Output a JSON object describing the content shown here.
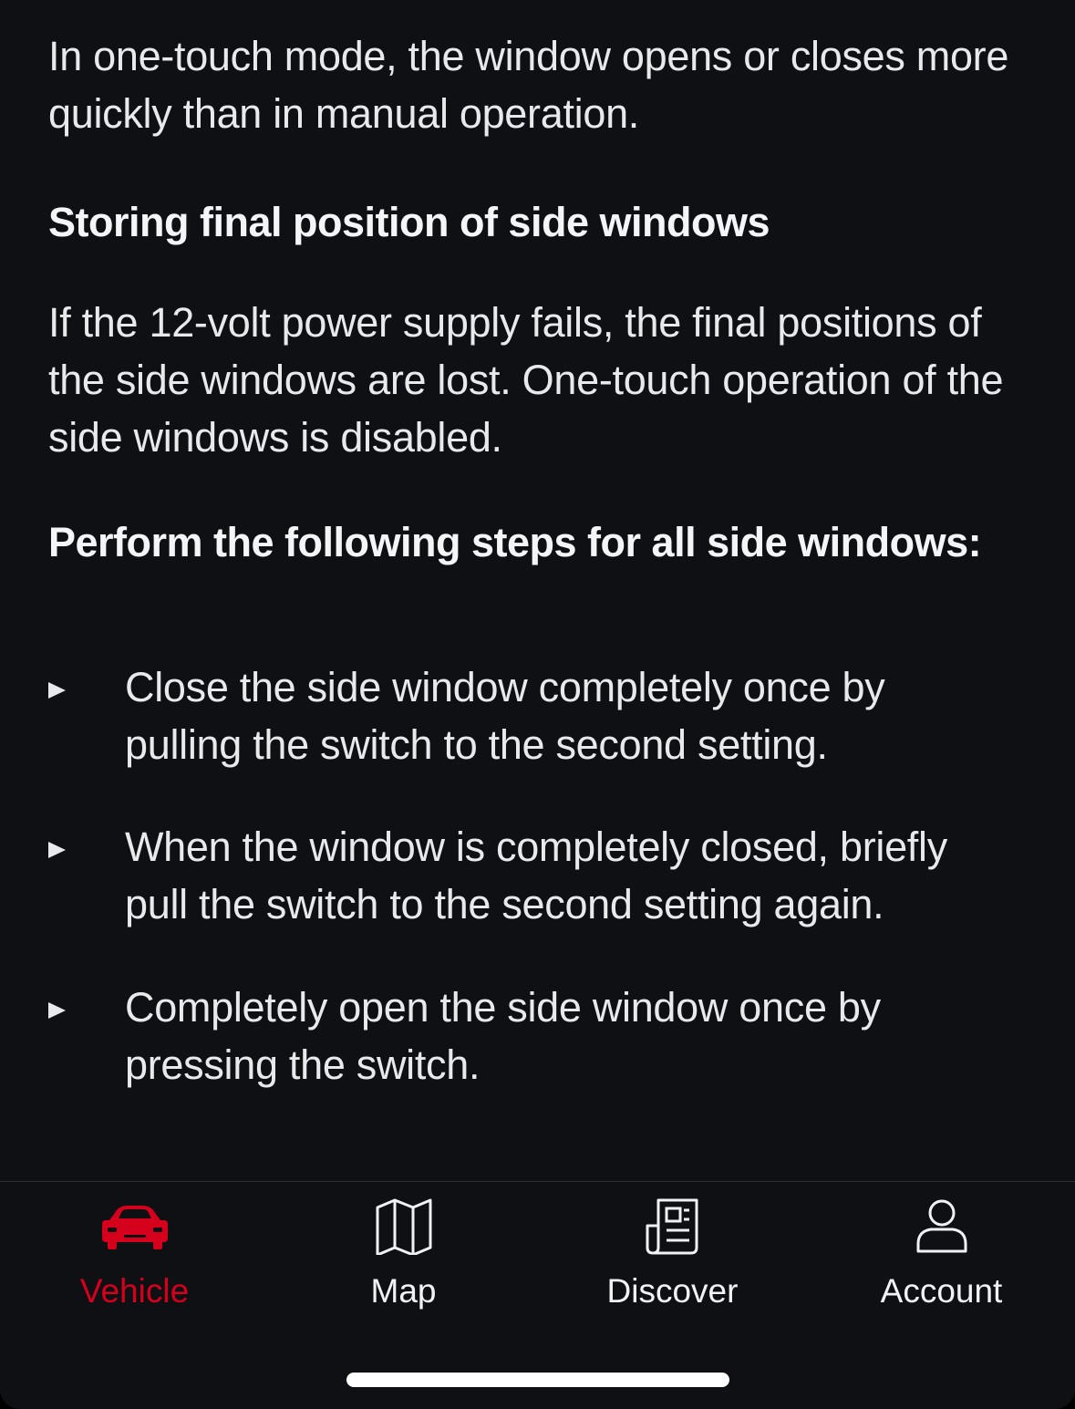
{
  "content": {
    "intro": "In one-touch mode, the window opens or closes more quickly than in manual operation.",
    "section_heading": "Storing final position of side windows",
    "section_text": "If the 12-volt power supply fails, the final positions of the side windows are lost. One-touch operation of the side windows is disabled.",
    "steps_heading": "Perform the following steps for all side windows:",
    "steps": [
      {
        "text": "Close the side window completely once by pulling the switch to the second setting."
      },
      {
        "text": "When the window is completely closed, briefly pull the switch to the second setting again."
      },
      {
        "text": "Completely open the side window once by pressing the switch."
      }
    ]
  },
  "tabbar": {
    "active": "Vehicle",
    "accent_color": "#d5001c",
    "tabs": [
      {
        "label": "Vehicle",
        "icon": "car-icon"
      },
      {
        "label": "Map",
        "icon": "map-icon"
      },
      {
        "label": "Discover",
        "icon": "newspaper-icon"
      },
      {
        "label": "Account",
        "icon": "person-icon"
      }
    ]
  }
}
